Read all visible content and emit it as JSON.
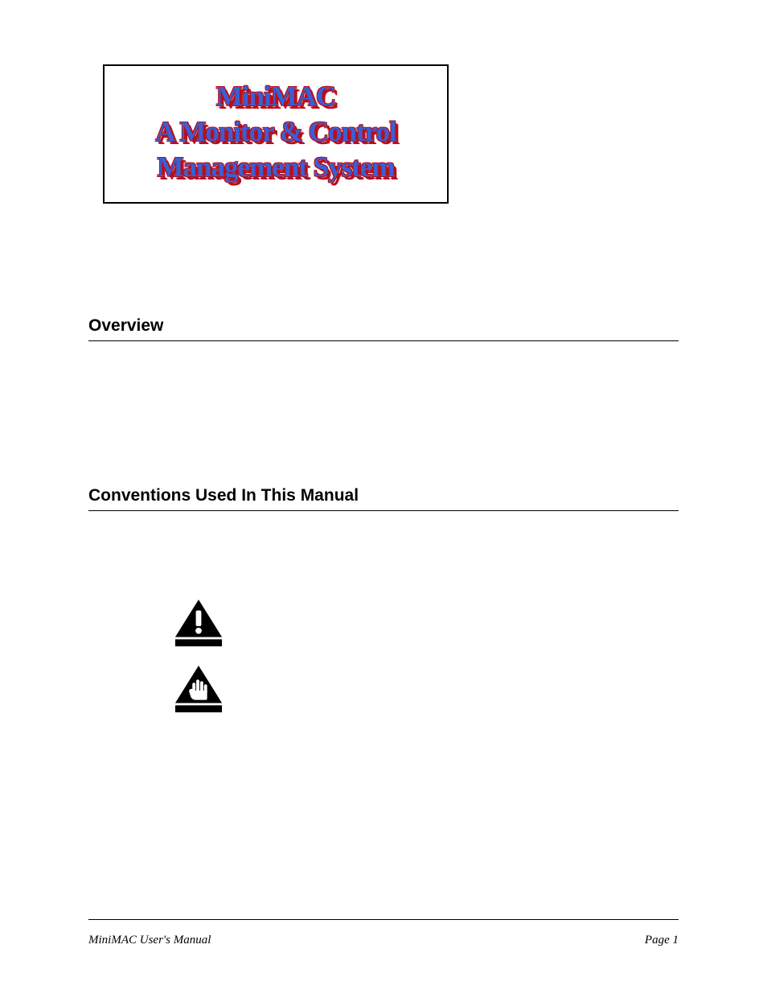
{
  "logo": {
    "line1": "MiniMAC",
    "line2": "A Monitor & Control",
    "line3": "Management System"
  },
  "sections": {
    "overview": "Overview",
    "conventions": "Conventions Used In This Manual"
  },
  "icons": {
    "caution": "caution-triangle-exclamation",
    "warning": "warning-triangle-hand"
  },
  "footer": {
    "left": "MiniMAC User's Manual",
    "right": "Page 1"
  }
}
